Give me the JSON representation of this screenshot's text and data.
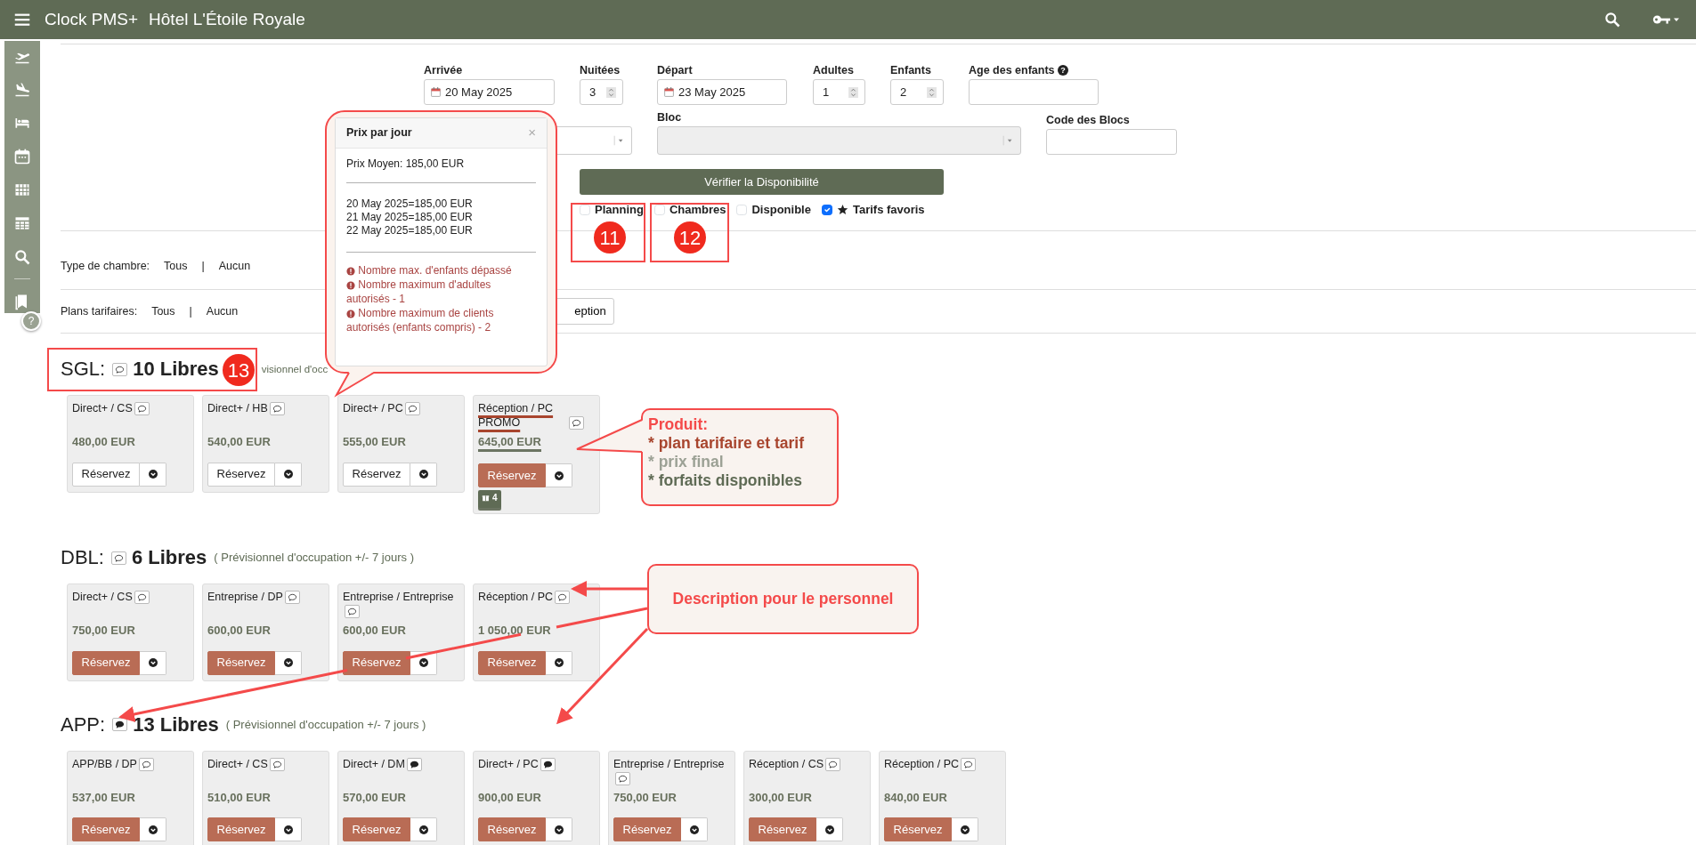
{
  "app": {
    "title": "Clock PMS+",
    "hotel": "Hôtel L'Étoile Royale"
  },
  "sidebar": {
    "help": "?"
  },
  "search_form": {
    "row1": [
      {
        "label": "Arrivée",
        "kind": "date",
        "value": "20 May 2025"
      },
      {
        "label": "Nuitées",
        "kind": "number",
        "value": "3"
      },
      {
        "label": "Départ",
        "kind": "date",
        "value": "23 May 2025"
      },
      {
        "label": "Adultes",
        "kind": "number",
        "value": "1"
      },
      {
        "label": "Enfants",
        "kind": "number",
        "value": "2"
      },
      {
        "label": "Age des enfants",
        "kind": "text",
        "help": "?"
      }
    ],
    "row2": [
      {
        "kind": "select",
        "disabled": false
      },
      {
        "label": "Bloc",
        "kind": "select",
        "disabled": true
      },
      {
        "label": "Code des Blocs",
        "kind": "text"
      }
    ],
    "check_button": "Vérifier la Disponibilité",
    "options": [
      {
        "label": "Planning",
        "checked": false,
        "kind": "plain"
      },
      {
        "label": "Chambres",
        "checked": false,
        "kind": "plain"
      },
      {
        "label": "Disponible",
        "checked": false,
        "kind": "plain"
      },
      {
        "label": "Tarifs favoris",
        "checked": true,
        "kind": "star"
      }
    ]
  },
  "filters": [
    {
      "label": "Type de chambre:",
      "all": "Tous",
      "separator": "|",
      "none": "Aucun"
    },
    {
      "label": "Plans tarifaires:",
      "all": "Tous",
      "separator": "|",
      "none": "Aucun",
      "button": "eption"
    }
  ],
  "room_types": [
    {
      "code": "SGL:",
      "note_filled": false,
      "free": "10 Libres",
      "forecast": "visionnel d'occ",
      "rates": [
        {
          "name": "Direct+ / CS",
          "note_filled": false,
          "price": "480,00 EUR",
          "button": "Réservez",
          "button_filled": false
        },
        {
          "name": "Direct+ / HB",
          "note_filled": false,
          "price": "540,00 EUR",
          "button": "Réservez",
          "button_filled": false
        },
        {
          "name": "Direct+ / PC",
          "note_filled": false,
          "price": "555,00 EUR",
          "button": "Réservez",
          "button_filled": false
        },
        {
          "name": "Réception / PC PROMO",
          "note_filled": false,
          "price": "645,00 EUR",
          "button": "Réservez",
          "button_filled": true,
          "annotated": true,
          "packages": "4"
        }
      ]
    },
    {
      "code": "DBL:",
      "note_filled": false,
      "free": "6 Libres",
      "forecast": "( Prévisionnel d'occupation +/- 7 jours )",
      "rates": [
        {
          "name": "Direct+ / CS",
          "note_filled": false,
          "price": "750,00 EUR",
          "button": "Réservez",
          "button_filled": true
        },
        {
          "name": "Entreprise / DP",
          "note_filled": false,
          "price": "600,00 EUR",
          "button": "Réservez",
          "button_filled": true
        },
        {
          "name": "Entreprise / Entreprise",
          "note_filled": false,
          "price": "600,00 EUR",
          "button": "Réservez",
          "button_filled": true
        },
        {
          "name": "Réception / PC",
          "note_filled": false,
          "price": "1 050,00 EUR",
          "button": "Réservez",
          "button_filled": true
        }
      ]
    },
    {
      "code": "APP:",
      "note_filled": true,
      "free": "13 Libres",
      "forecast": "( Prévisionnel d'occupation +/- 7 jours )",
      "rates": [
        {
          "name": "APP/BB / DP",
          "note_filled": false,
          "price": "537,00 EUR",
          "button": "Réservez",
          "button_filled": true
        },
        {
          "name": "Direct+ / CS",
          "note_filled": false,
          "price": "510,00 EUR",
          "button": "Réservez",
          "button_filled": true
        },
        {
          "name": "Direct+ / DM",
          "note_filled": true,
          "price": "570,00 EUR",
          "button": "Réservez",
          "button_filled": true
        },
        {
          "name": "Direct+ / PC",
          "note_filled": true,
          "price": "900,00 EUR",
          "button": "Réservez",
          "button_filled": true
        },
        {
          "name": "Entreprise / Entreprise",
          "note_filled": false,
          "price": "750,00 EUR",
          "button": "Réservez",
          "button_filled": true
        },
        {
          "name": "Réception / CS",
          "note_filled": false,
          "price": "300,00 EUR",
          "button": "Réservez",
          "button_filled": true
        },
        {
          "name": "Réception / PC",
          "note_filled": false,
          "price": "840,00 EUR",
          "button": "Réservez",
          "button_filled": true
        }
      ]
    }
  ],
  "price_popover": {
    "title": "Prix par jour",
    "close": "×",
    "average": "Prix Moyen: 185,00 EUR",
    "days": [
      "20 May 2025=185,00 EUR",
      "21 May 2025=185,00 EUR",
      "22 May 2025=185,00 EUR"
    ],
    "warnings": [
      "Nombre max. d'enfants dépassé",
      "Nombre maximum d'adultes autorisés - 1",
      "Nombre maximum de clients autorisés (enfants compris) - 2"
    ]
  },
  "annotations": {
    "markers": [
      "11",
      "12",
      "13"
    ],
    "callouts": [
      {
        "lines": [
          {
            "text": "Produit:",
            "color": "#f44a4a"
          },
          {
            "text": "* plan tarifaire et tarif",
            "color": "#a8452e"
          },
          {
            "text": "* prix final",
            "color": "#9ca195"
          },
          {
            "text": "* forfaits disponibles",
            "color": "#5f6b55"
          }
        ]
      },
      {
        "lines": [
          {
            "text": "Description pour le personnel",
            "color": "#f44a4a"
          }
        ]
      }
    ]
  }
}
